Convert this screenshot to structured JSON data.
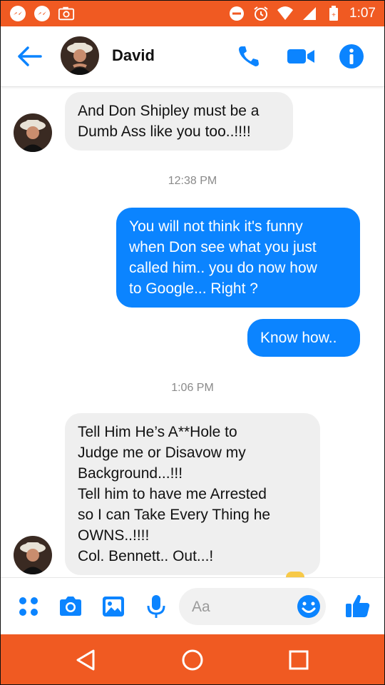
{
  "status_bar": {
    "time": "1:07",
    "left_icons": [
      "messenger-icon",
      "messenger-icon",
      "photo-icon"
    ],
    "right_icons": [
      "dnd-icon",
      "alarm-icon",
      "wifi-icon",
      "signal-icon",
      "battery-icon"
    ]
  },
  "header": {
    "contact_name": "David",
    "icons": [
      "back-arrow-icon",
      "phone-icon",
      "video-call-icon",
      "info-icon"
    ]
  },
  "messages": [
    {
      "direction": "incoming",
      "lines": [
        "And Don Shipley must be a",
        "Dumb Ass like you too..!!!!"
      ]
    },
    {
      "type": "timestamp",
      "text": "12:38 PM"
    },
    {
      "direction": "outgoing",
      "lines": [
        "You will not think it's funny",
        "when Don see what you just",
        "called him.. you do now how",
        "to Google... Right ?"
      ]
    },
    {
      "direction": "outgoing",
      "lines": [
        "Know how.."
      ]
    },
    {
      "type": "timestamp",
      "text": "1:06 PM"
    },
    {
      "direction": "incoming",
      "lines": [
        "Tell Him He’s A**Hole to",
        "Judge me or Disavow my",
        "Background...!!!",
        "Tell him to have me Arrested",
        "so I can Take Every Thing he",
        "OWNS..!!!!",
        "Col. Bennett.. Out...!"
      ]
    }
  ],
  "composer": {
    "placeholder": "Aa",
    "value": "",
    "icons": [
      "apps-icon",
      "camera-icon",
      "gallery-icon",
      "microphone-icon",
      "emoji-icon",
      "thumbs-up-icon"
    ]
  },
  "nav_bar": {
    "icons": [
      "back-triangle-icon",
      "home-circle-icon",
      "recents-square-icon"
    ]
  },
  "colors": {
    "accent_orange": "#f05a22",
    "messenger_blue": "#0b84ff",
    "incoming_bubble": "#efefef",
    "timestamp_gray": "#8a8a8a"
  }
}
